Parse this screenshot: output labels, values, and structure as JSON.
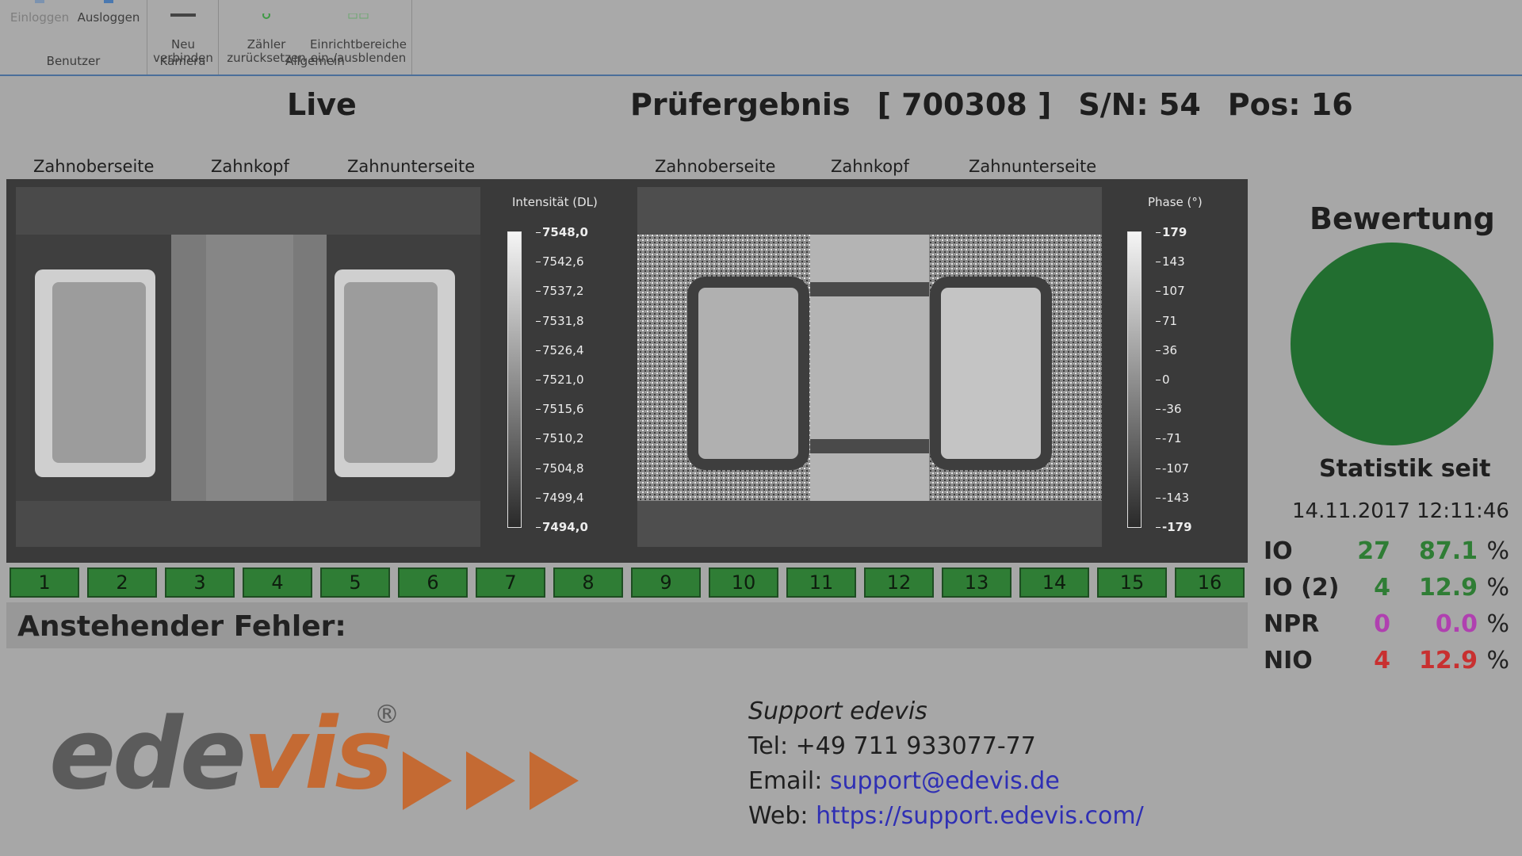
{
  "ribbon": {
    "groups": [
      {
        "label": "Benutzer",
        "buttons": [
          {
            "label": "Einloggen",
            "disabled": true
          },
          {
            "label": "Ausloggen",
            "disabled": false
          }
        ]
      },
      {
        "label": "Kamera",
        "buttons": [
          {
            "label": "Neu\nverbinden",
            "disabled": false
          }
        ]
      },
      {
        "label": "Allgemein",
        "buttons": [
          {
            "label": "Zähler\nzurücksetzen",
            "disabled": false
          },
          {
            "label": "Einrichtbereiche\nein-/ausblenden",
            "disabled": false
          }
        ]
      }
    ]
  },
  "live_title": "Live",
  "result": {
    "title": "Prüfergebnis",
    "id": "[ 700308 ]",
    "serial": "S/N: 54",
    "pos": "Pos: 16"
  },
  "view_labels": {
    "top_side": "Zahnoberseite",
    "tip": "Zahnkopf",
    "bottom_side": "Zahnunterseite"
  },
  "intensity_scale": {
    "title": "Intensität (DL)",
    "ticks": [
      "7548,0",
      "7542,6",
      "7537,2",
      "7531,8",
      "7526,4",
      "7521,0",
      "7515,6",
      "7510,2",
      "7504,8",
      "7499,4",
      "7494,0"
    ]
  },
  "phase_scale": {
    "title": "Phase (°)",
    "ticks": [
      "179",
      "143",
      "107",
      "71",
      "36",
      "0",
      "-36",
      "-71",
      "-107",
      "-143",
      "-179"
    ]
  },
  "positions": [
    "1",
    "2",
    "3",
    "4",
    "5",
    "6",
    "7",
    "8",
    "9",
    "10",
    "11",
    "12",
    "13",
    "14",
    "15",
    "16"
  ],
  "colors": {
    "position_ok": "#2f7d35",
    "evaluation_ok": "#226e30",
    "io": "#2f7d35",
    "npr": "#b040b0",
    "nio": "#c83030"
  },
  "error_label": "Anstehender Fehler:",
  "evaluation_title": "Bewertung",
  "statistics": {
    "title": "Statistik seit",
    "since": "14.11.2017 12:11:46",
    "unit": "%",
    "rows": [
      {
        "label": "IO",
        "count": "27",
        "percent": "87.1",
        "color": "green"
      },
      {
        "label": "IO (2)",
        "count": "4",
        "percent": "12.9",
        "color": "green"
      },
      {
        "label": "NPR",
        "count": "0",
        "percent": "0.0",
        "color": "magenta"
      },
      {
        "label": "NIO",
        "count": "4",
        "percent": "12.9",
        "color": "red"
      }
    ]
  },
  "logo": {
    "part1": "ede",
    "part2": "vis",
    "reg": "®"
  },
  "support": {
    "heading": "Support edevis",
    "tel": "Tel: +49 711 933077-77",
    "email_label": "Email:",
    "email": "support@edevis.de",
    "web_label": "Web:",
    "web": "https://support.edevis.com/"
  }
}
